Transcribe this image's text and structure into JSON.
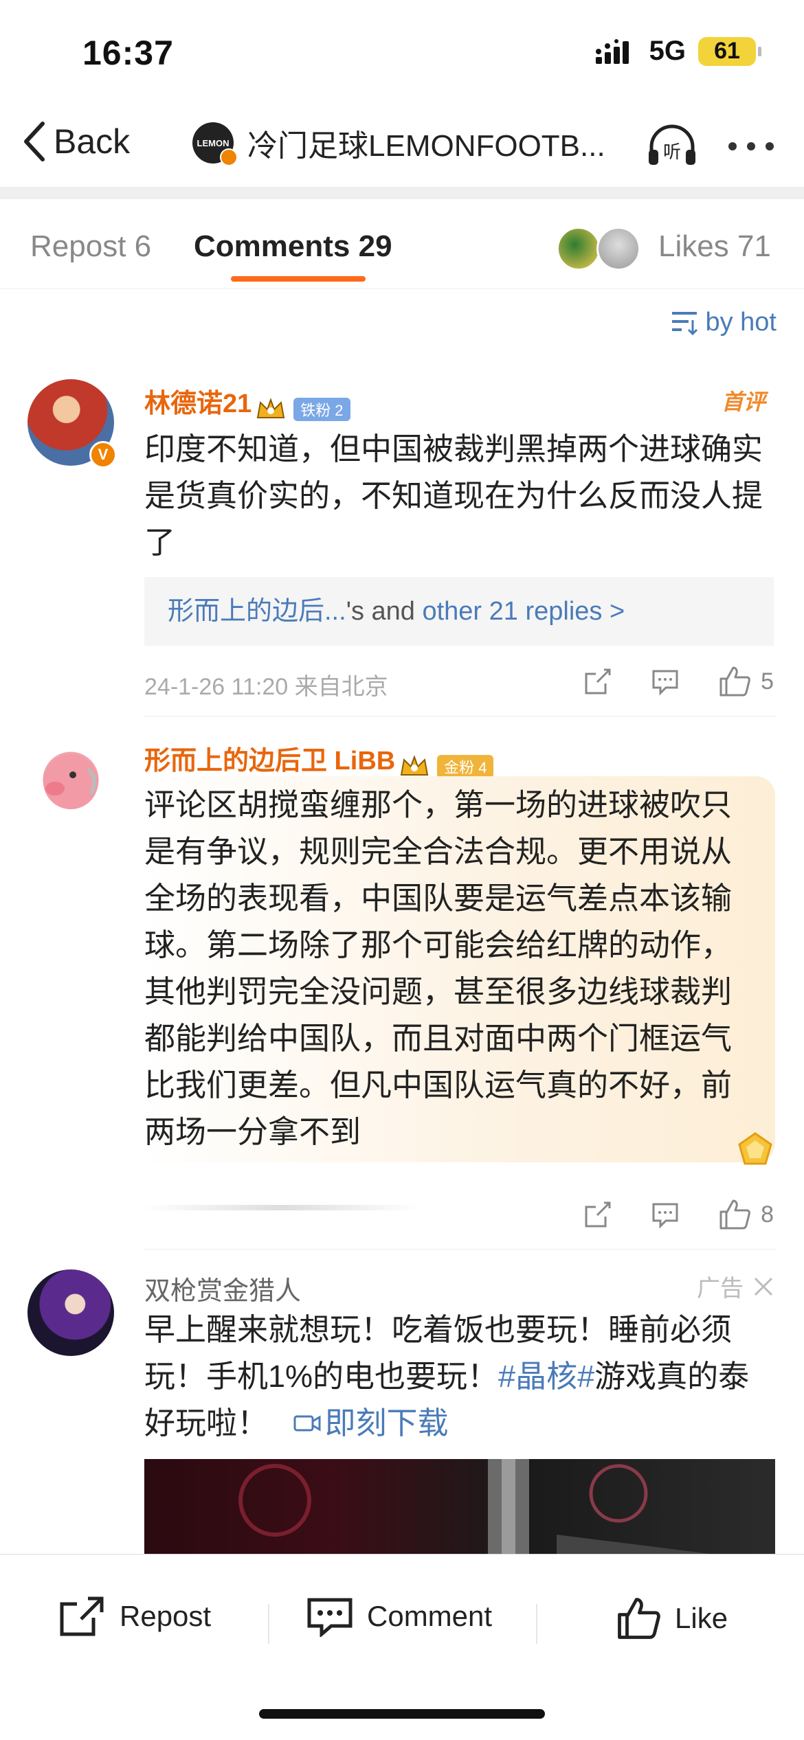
{
  "status_bar": {
    "time": "16:37",
    "network": "5G",
    "battery": "61"
  },
  "nav": {
    "back_label": "Back",
    "title": "冷门足球LEMONFOOTB...",
    "logo_text": "LEMON",
    "listen_label": "听",
    "more_icon": "more-dots-icon"
  },
  "tabs": {
    "repost": "Repost 6",
    "comments": "Comments 29",
    "likes": "Likes 71"
  },
  "sort": {
    "label": "by hot"
  },
  "comments": [
    {
      "username": "林德诺21",
      "fan_badge": "铁粉 2",
      "first_comment_tag": "首评",
      "text": "印度不知道，但中国被裁判黑掉两个进球确实是货真价实的，不知道现在为什么反而没人提了",
      "replies_prefix": "形而上的边后...",
      "replies_mid": "'s and ",
      "replies_link": "other 21 replies >",
      "time_location": "24-1-26 11:20 来自北京",
      "likes": "5"
    },
    {
      "username": "形而上的边后卫 LiBB",
      "fan_badge": "金粉 4",
      "text": "评论区胡搅蛮缠那个，第一场的进球被吹只是有争议，规则完全合法合规。更不用说从全场的表现看，中国队要是运气差点本该输球。第二场除了那个可能会给红牌的动作，其他判罚完全没问题，甚至很多边线球裁判都能判给中国队，而且对面中两个门框运气比我们更差。但凡中国队运气真的不好，前两场一分拿不到",
      "likes": "8"
    }
  ],
  "ad": {
    "username": "双枪赏金猎人",
    "ad_label": "广告",
    "text_before": "早上醒来就想玩！吃着饭也要玩！睡前必须玩！手机1%的电也要玩！",
    "hashtag": "#晶核#",
    "text_after": "游戏真的泰好玩啦！",
    "download_label": "即刻下载"
  },
  "bottom_bar": {
    "repost": "Repost",
    "comment": "Comment",
    "like": "Like"
  },
  "colors": {
    "accent_orange": "#ff6a1a",
    "link_blue": "#4a7bb8",
    "username_orange": "#e8660c"
  }
}
